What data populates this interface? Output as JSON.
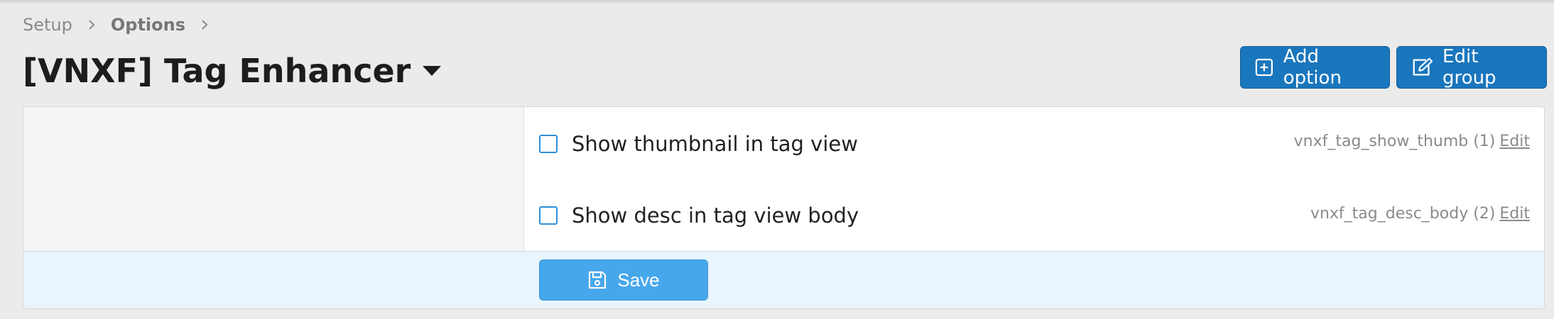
{
  "breadcrumb": {
    "items": [
      "Setup",
      "Options"
    ]
  },
  "page": {
    "title": "[VNXF] Tag Enhancer"
  },
  "header_buttons": {
    "add_option": "Add option",
    "edit_group": "Edit group"
  },
  "options": [
    {
      "key": "vnxf_tag_show_thumb (1)",
      "edit": "Edit",
      "label": "Show thumbnail in tag view",
      "checked": false
    },
    {
      "key": "vnxf_tag_desc_body (2)",
      "edit": "Edit",
      "label": "Show desc in tag view body",
      "checked": false
    }
  ],
  "footer": {
    "save_label": "Save"
  },
  "colors": {
    "primary": "#1a76bd",
    "save": "#47a7eb",
    "footer_bg": "#e9f4fd"
  }
}
